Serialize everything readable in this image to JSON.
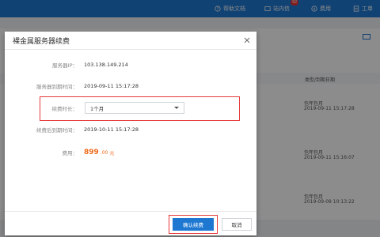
{
  "topbar": {
    "help_label": "帮助文档",
    "messages_label": "站内信",
    "messages_badge": "92",
    "billing_label": "费用",
    "workorder_label": "工单"
  },
  "background": {
    "col_header": "类型/到期日期",
    "rows": [
      {
        "type": "包年包月",
        "date": "2019-09-11 15:17:28"
      },
      {
        "type": "包年包月",
        "date": "2019-09-11 15:16:07"
      },
      {
        "type": "包年包月",
        "date": "2019-09-09 10:13:22"
      }
    ]
  },
  "modal": {
    "title": "裸金属服务器续费",
    "fields": {
      "ip_label": "服务器IP：",
      "ip_value": "103.138.149.214",
      "expire_label": "服务器到期时间：",
      "expire_value": "2019-09-11 15:17:28",
      "duration_label": "续费时长：",
      "duration_value": "1个月",
      "new_expire_label": "续费后到期时间：",
      "new_expire_value": "2019-10-11 15:17:28",
      "cost_label": "费用：",
      "cost_value": "899",
      "cost_decimal": ".00",
      "cost_unit": "元"
    },
    "buttons": {
      "confirm": "确认续费",
      "cancel": "取消"
    }
  }
}
